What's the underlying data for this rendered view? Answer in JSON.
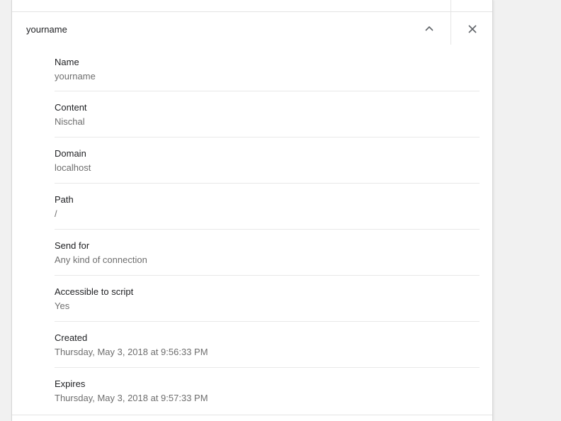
{
  "cookie": {
    "title": "yourname",
    "collapse_icon": "chevron-up-icon",
    "close_icon": "close-icon"
  },
  "fields": [
    {
      "label": "Name",
      "value": "yourname"
    },
    {
      "label": "Content",
      "value": "Nischal"
    },
    {
      "label": "Domain",
      "value": "localhost"
    },
    {
      "label": "Path",
      "value": "/"
    },
    {
      "label": "Send for",
      "value": "Any kind of connection"
    },
    {
      "label": "Accessible to script",
      "value": "Yes"
    },
    {
      "label": "Created",
      "value": "Thursday, May 3, 2018 at 9:56:33 PM"
    },
    {
      "label": "Expires",
      "value": "Thursday, May 3, 2018 at 9:57:33 PM"
    }
  ]
}
